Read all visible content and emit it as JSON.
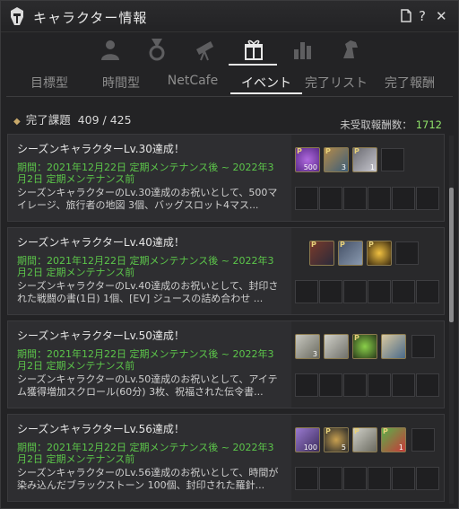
{
  "window": {
    "title": "キャラクター情報"
  },
  "tabs": [
    {
      "label": "目標型"
    },
    {
      "label": "時間型"
    },
    {
      "label": "NetCafe"
    },
    {
      "label": "イベント"
    },
    {
      "label": "完了リスト"
    },
    {
      "label": "完了報酬"
    }
  ],
  "active_tab": "イベント",
  "summary": {
    "label": "完了課題",
    "count": "409 / 425"
  },
  "unclaimed": {
    "label": "未受取報酬数：",
    "value": "1712"
  },
  "quests": [
    {
      "title": "シーズンキャラクターLv.30達成！",
      "period": "期間：2021年12月22日 定期メンテナンス後 ~ 2022年3月2日 定期メンテナンス前",
      "desc": "シーズンキャラクターのLv.30達成のお祝いとして、500マイレージ、旅行者の地図 3個、バッグスロット4マス...",
      "items": [
        {
          "icon": "purple-coin",
          "qty": "500"
        },
        {
          "icon": "traveler-map",
          "qty": "3"
        },
        {
          "icon": "bag-slot",
          "qty": "1"
        }
      ]
    },
    {
      "title": "シーズンキャラクターLv.40達成！",
      "period": "期間：2021年12月22日 定期メンテナンス後 ~ 2022年3月2日 定期メンテナンス前",
      "desc": "シーズンキャラクターのLv.40達成のお祝いとして、封印された戦闘の書(1日) 1個、[EV] ジュースの詰め合わせ ...",
      "items": [
        {
          "icon": "sealed-book",
          "qty": ""
        },
        {
          "icon": "juice-box",
          "qty": ""
        },
        {
          "icon": "gold-sparkle",
          "qty": ""
        }
      ]
    },
    {
      "title": "シーズンキャラクターLv.50達成！",
      "period": "期間：2021年12月22日 定期メンテナンス後 ~ 2022年3月2日 定期メンテナンス前",
      "desc": "シーズンキャラクターのLv.50達成のお祝いとして、アイテム獲得増加スクロール(60分) 3枚、祝福された伝令書...",
      "items": [
        {
          "icon": "scroll",
          "qty": "3"
        },
        {
          "icon": "scroll-2",
          "qty": ""
        },
        {
          "icon": "green-potion",
          "qty": ""
        },
        {
          "icon": "landscape-scroll",
          "qty": ""
        }
      ]
    },
    {
      "title": "シーズンキャラクターLv.56達成！",
      "period": "期間：2021年12月22日 定期メンテナンス後 ~ 2022年3月2日 定期メンテナンス前",
      "desc": "シーズンキャラクターのLv.56達成のお祝いとして、時間が染み込んだブラックストーン 100個、封印された羅針...",
      "items": [
        {
          "icon": "black-stone",
          "qty": "100"
        },
        {
          "icon": "compass",
          "qty": "5"
        },
        {
          "icon": "scroll",
          "qty": ""
        },
        {
          "icon": "gift-box",
          "qty": "1"
        }
      ]
    }
  ]
}
